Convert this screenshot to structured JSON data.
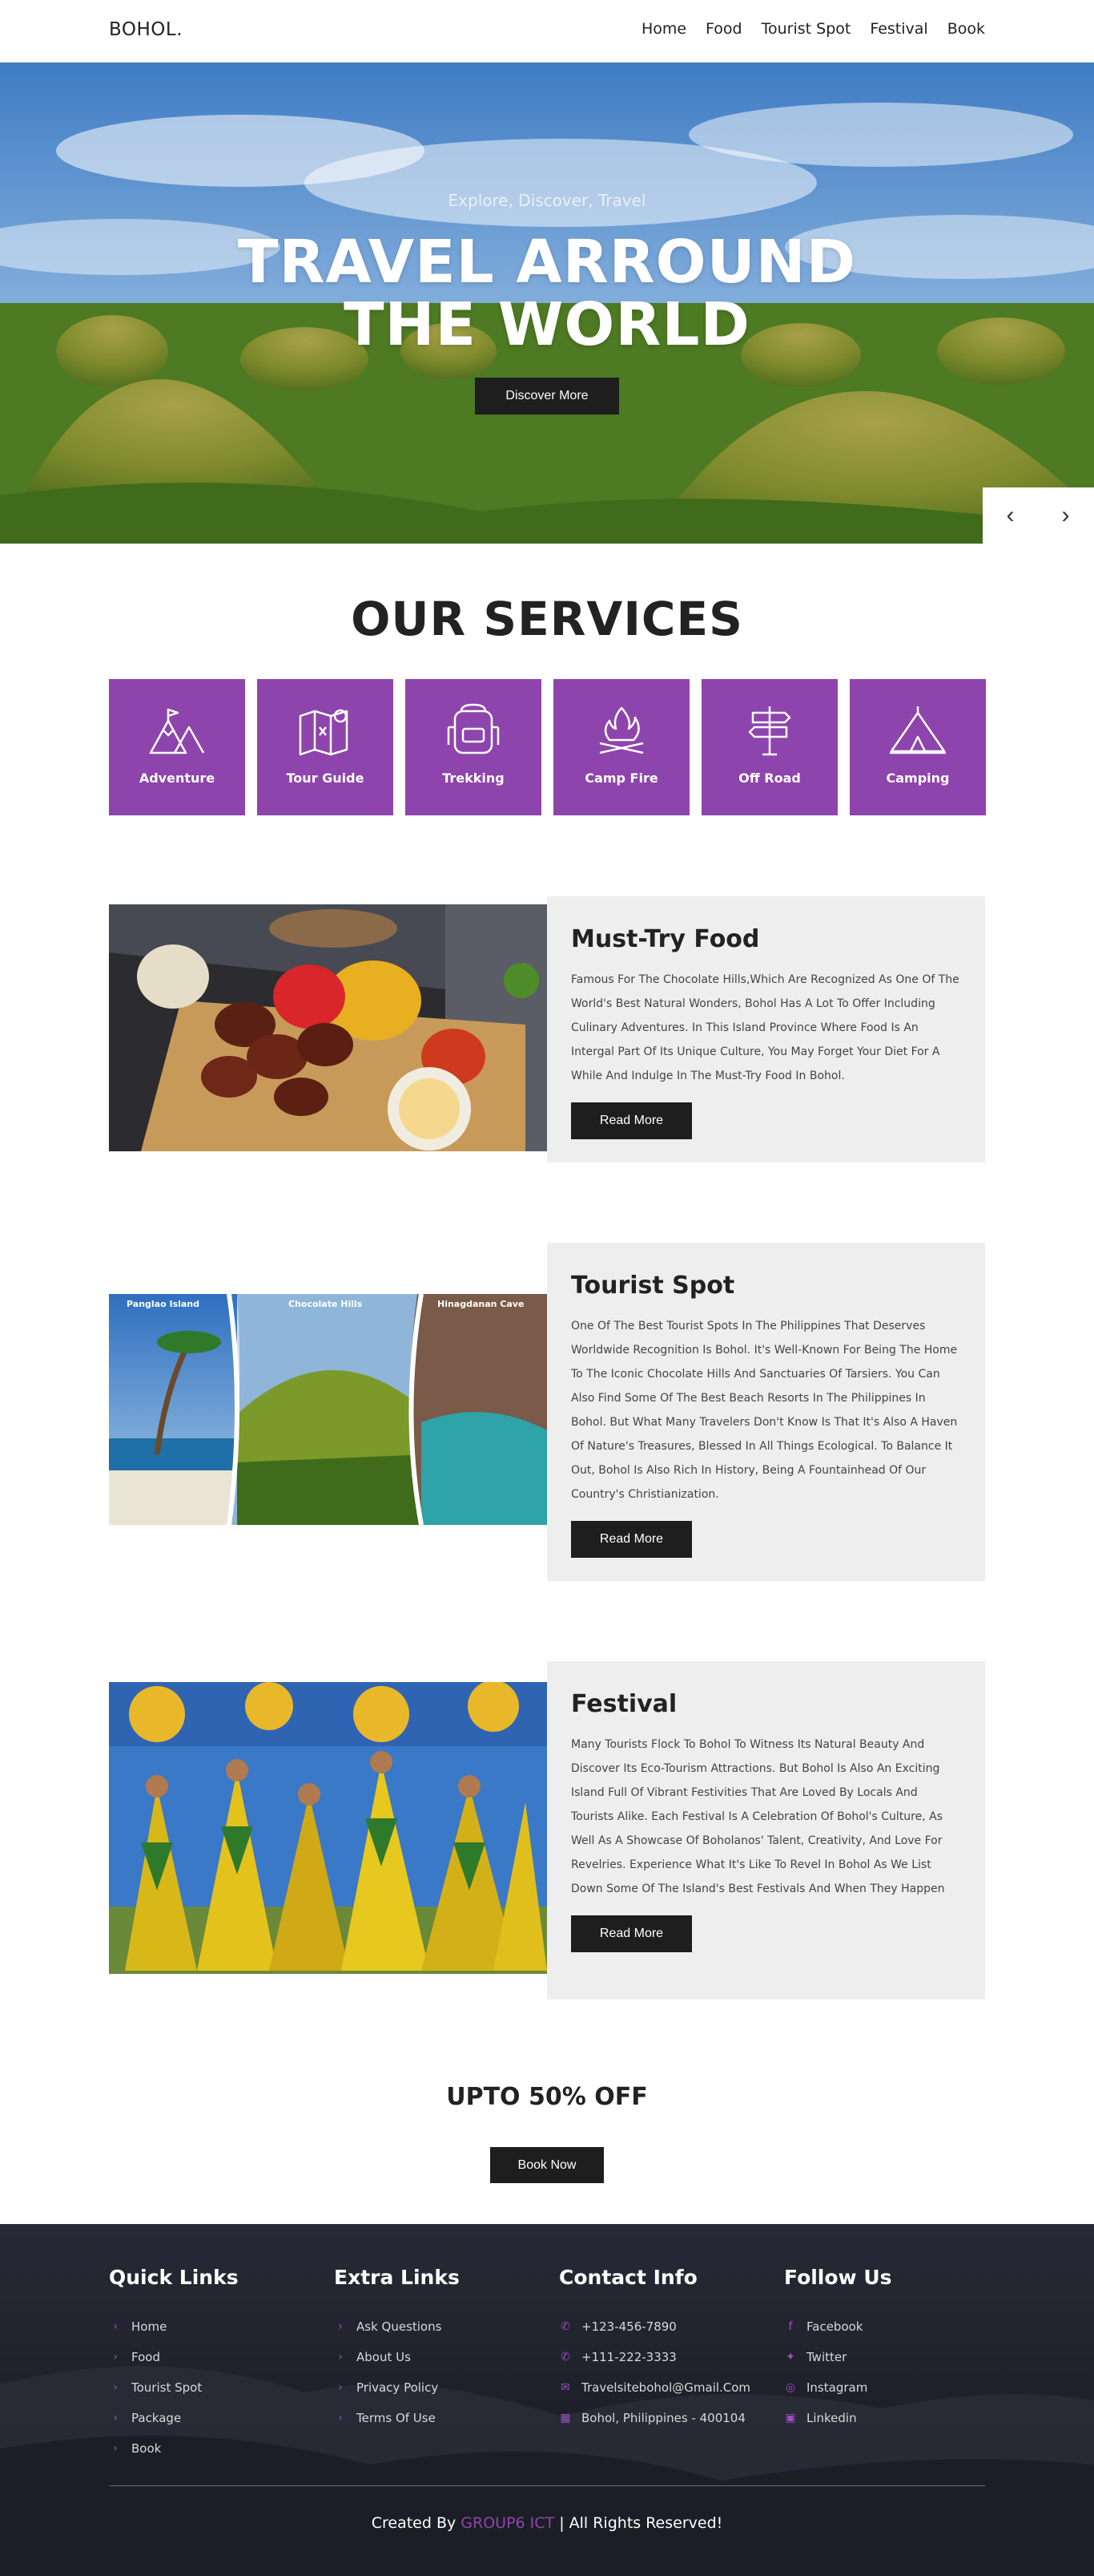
{
  "header": {
    "logo": "BOHOL.",
    "nav": [
      "Home",
      "Food",
      "Tourist Spot",
      "Festival",
      "Book"
    ]
  },
  "hero": {
    "subtitle": "Explore, Discover, Travel",
    "title_line1": "TRAVEL ARROUND",
    "title_line2": "THE WORLD",
    "button": "Discover More",
    "prev_icon": "‹",
    "next_icon": "›"
  },
  "services": {
    "title": "OUR SERVICES",
    "items": [
      {
        "label": "Adventure",
        "icon": "mountain-icon"
      },
      {
        "label": "Tour Guide",
        "icon": "map-icon"
      },
      {
        "label": "Trekking",
        "icon": "backpack-icon"
      },
      {
        "label": "Camp Fire",
        "icon": "campfire-icon"
      },
      {
        "label": "Off Road",
        "icon": "signpost-icon"
      },
      {
        "label": "Camping",
        "icon": "tent-icon"
      }
    ],
    "accent": "#8e44ad"
  },
  "features": [
    {
      "title": "Must-Try Food",
      "text": "Famous For The Chocolate Hills,Which Are Recognized As One Of The World's Best Natural Wonders, Bohol Has A Lot To Offer Including Culinary Adventures. In This Island Province Where Food Is An Intergal Part Of Its Unique Culture, You May Forget Your Diet For A While And Indulge In The Must-Try Food In Bohol.",
      "button": "Read More"
    },
    {
      "title": "Tourist Spot",
      "text": "One Of The Best Tourist Spots In The Philippines That Deserves Worldwide Recognition Is Bohol. It's Well-Known For Being The Home To The Iconic Chocolate Hills And Sanctuaries Of Tarsiers. You Can Also Find Some Of The Best Beach Resorts In The Philippines In Bohol. But What Many Travelers Don't Know Is That It's Also A Haven Of Nature's Treasures, Blessed In All Things Ecological. To Balance It Out, Bohol Is Also Rich In History, Being A Fountainhead Of Our Country's Christianization.",
      "button": "Read More",
      "image_labels": [
        "Panglao Island",
        "Chocolate Hills",
        "Hinagdanan Cave"
      ]
    },
    {
      "title": "Festival",
      "text": "Many Tourists Flock To Bohol To Witness Its Natural Beauty And Discover Its Eco-Tourism Attractions. But Bohol Is Also An Exciting Island Full Of Vibrant Festivities That Are Loved By Locals And Tourists Alike. Each Festival Is A Celebration Of Bohol's Culture, As Well As A Showcase Of Boholanos' Talent, Creativity, And Love For Revelries. Experience What It's Like To Revel In Bohol As We List Down Some Of The Island's Best Festivals And When They Happen",
      "button": "Read More"
    }
  ],
  "offer": {
    "title": "UPTO 50% OFF",
    "button": "Book Now"
  },
  "footer": {
    "quick_links": {
      "title": "Quick Links",
      "items": [
        "Home",
        "Food",
        "Tourist Spot",
        "Package",
        "Book"
      ]
    },
    "extra_links": {
      "title": "Extra Links",
      "items": [
        "Ask Questions",
        "About Us",
        "Privacy Policy",
        "Terms Of Use"
      ]
    },
    "contact": {
      "title": "Contact Info",
      "items": [
        {
          "icon": "phone-icon",
          "text": "+123-456-7890"
        },
        {
          "icon": "phone-icon",
          "text": "+111-222-3333"
        },
        {
          "icon": "envelope-icon",
          "text": "Travelsitebohol@Gmail.Com"
        },
        {
          "icon": "map-icon",
          "text": "Bohol, Philippines - 400104"
        }
      ]
    },
    "follow": {
      "title": "Follow Us",
      "items": [
        {
          "icon": "facebook-icon",
          "text": "Facebook"
        },
        {
          "icon": "twitter-icon",
          "text": "Twitter"
        },
        {
          "icon": "instagram-icon",
          "text": "Instagram"
        },
        {
          "icon": "linkedin-icon",
          "text": "Linkedin"
        }
      ]
    },
    "credit_prefix": "Created By",
    "credit_brand": "GROUP6 ICT",
    "credit_suffix": "| All Rights Reserved!"
  }
}
